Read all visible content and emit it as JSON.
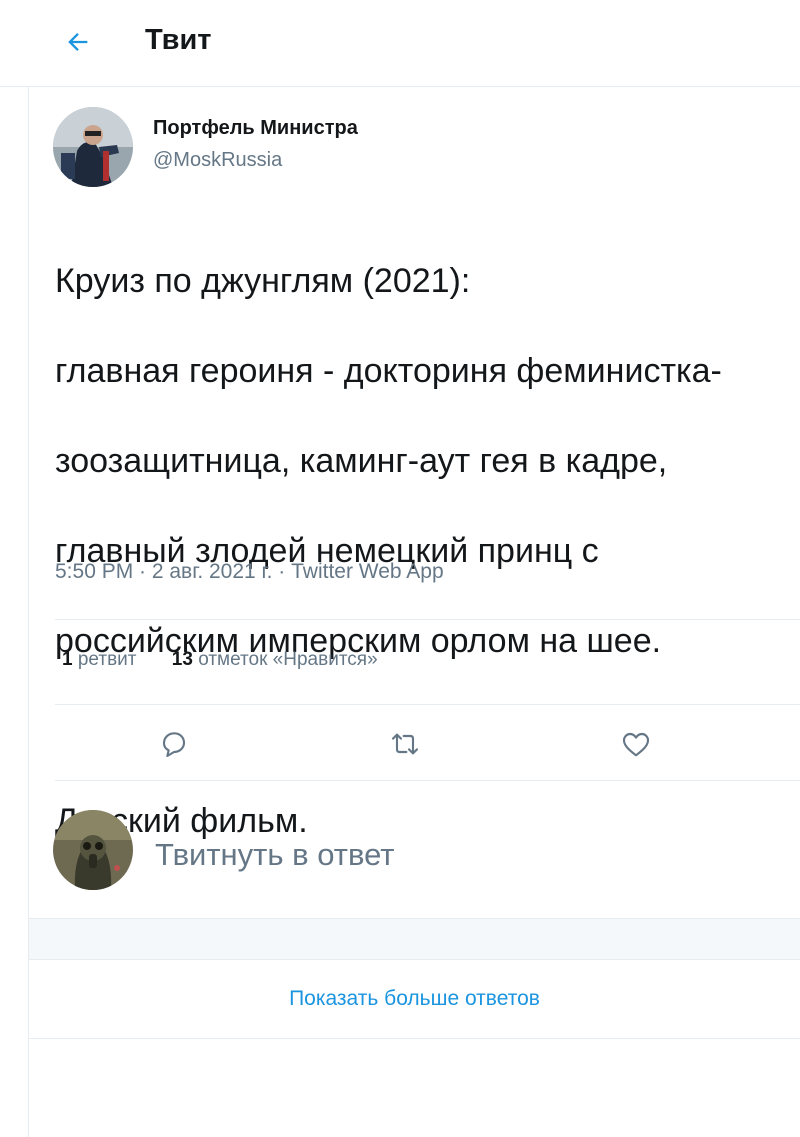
{
  "header": {
    "back_icon": "arrow-left-icon",
    "title": "Твит"
  },
  "tweet": {
    "author_name": "Портфель Министра",
    "author_handle": "@MoskRussia",
    "text_lines": [
      "Круиз по джунглям (2021):",
      "главная героиня - докториня феминистка-",
      "зоозащитница, каминг-аут гея в кадре,",
      "главный злодей немецкий принц с",
      "российским имперским орлом на шее.",
      "",
      "Детский фильм."
    ],
    "meta": "5:50 PM · 2 авг. 2021 г. · Twitter Web App",
    "stats": {
      "retweets_count": "1",
      "retweets_label": "ретвит",
      "likes_count": "13",
      "likes_label": "отметок «Нравится»"
    },
    "actions": [
      "reply-icon",
      "retweet-icon",
      "like-icon"
    ]
  },
  "reply": {
    "placeholder": "Твитнуть в ответ"
  },
  "show_more": "Показать больше ответов",
  "colors": {
    "accent": "#1b95e0",
    "text": "#14171a",
    "secondary": "#657786",
    "divider": "#e6ecf0"
  }
}
